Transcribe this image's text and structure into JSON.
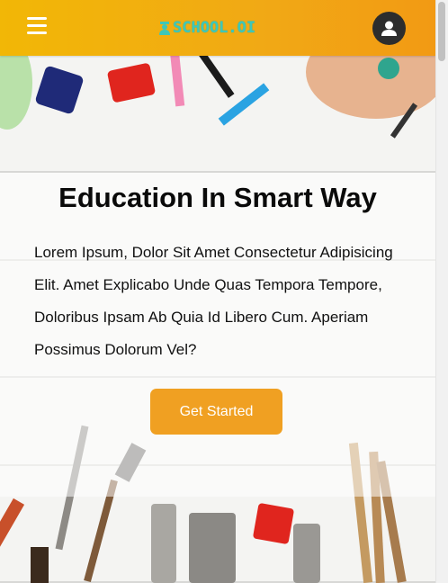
{
  "header": {
    "logo_text": "SCHOOL.OI",
    "menu_icon": "hamburger-icon",
    "account_icon": "user-circle-icon"
  },
  "hero": {
    "headline": "Education In Smart Way",
    "lede": "Lorem Ipsum, Dolor Sit Amet Consectetur Adipisicing Elit. Amet Explicabo Unde Quas Tempora Tempore, Doloribus Ipsam Ab Quia Id Libero Cum. Aperiam Possimus Dolorum Vel?",
    "cta_label": "Get Started"
  },
  "colors": {
    "header_start": "#f2b706",
    "header_end": "#f29a14",
    "logo": "#3ec7b8",
    "cta": "#f0a022",
    "avatar": "#2d2d2d"
  }
}
